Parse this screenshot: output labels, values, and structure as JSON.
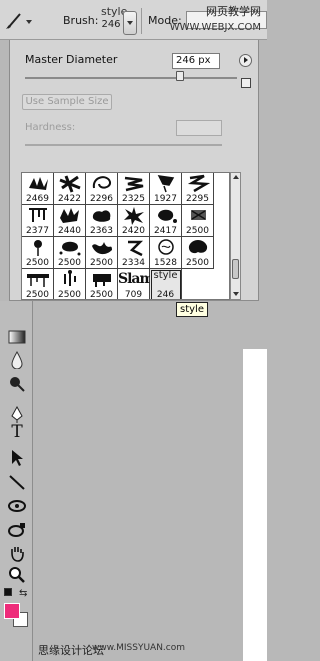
{
  "options_bar": {
    "brush_label": "Brush:",
    "preset_name": "style",
    "preset_size": "246",
    "mode_label": "Mode:",
    "watermark_top": "网页教学网",
    "watermark_bottom": "WWW.WEBJX.COM"
  },
  "brush_panel": {
    "master_diameter_label": "Master Diameter",
    "master_diameter_value": "246 px",
    "master_diameter_fraction": 0.74,
    "use_sample_size_label": "Use Sample Size",
    "hardness_label": "Hardness:",
    "presets": [
      {
        "size": "2469",
        "shape": "splat-a"
      },
      {
        "size": "2422",
        "shape": "splat-b"
      },
      {
        "size": "2296",
        "shape": "swirl"
      },
      {
        "size": "2325",
        "shape": "scribble"
      },
      {
        "size": "1927",
        "shape": "tag"
      },
      {
        "size": "2295",
        "shape": "zig"
      },
      {
        "size": "2377",
        "shape": "drip"
      },
      {
        "size": "2440",
        "shape": "splat-c"
      },
      {
        "size": "2363",
        "shape": "cloud"
      },
      {
        "size": "2420",
        "shape": "burst"
      },
      {
        "size": "2417",
        "shape": "splat-d"
      },
      {
        "size": "2500",
        "shape": "spray"
      },
      {
        "size": "2500",
        "shape": "drop"
      },
      {
        "size": "2500",
        "shape": "blot"
      },
      {
        "size": "2500",
        "shape": "mess"
      },
      {
        "size": "2334",
        "shape": "hook"
      },
      {
        "size": "1528",
        "shape": "circle"
      },
      {
        "size": "2500",
        "shape": "splat-e"
      },
      {
        "size": "2500",
        "shape": "line-drip"
      },
      {
        "size": "2500",
        "shape": "pins"
      },
      {
        "size": "2500",
        "shape": "splat-f"
      },
      {
        "size": "709",
        "shape": "slam",
        "text": "Slam"
      },
      {
        "size": "246",
        "shape": "style-text",
        "text": "style"
      }
    ],
    "selected_tooltip": "style"
  },
  "toolbox": {
    "tools": [
      "gradient-tool",
      "blur-tool",
      "dodge-tool",
      "pen-tool",
      "type-tool",
      "path-selection-tool",
      "line-tool",
      "3d-rotate-tool",
      "3d-orbit-tool",
      "hand-tool",
      "zoom-tool"
    ],
    "type_glyph": "T"
  },
  "colors": {
    "foreground": "#ee2c7a",
    "background": "#ffffff"
  },
  "footer": {
    "site_cn": "思缘设计论坛",
    "site_url": "www.MISSYUAN.com"
  }
}
